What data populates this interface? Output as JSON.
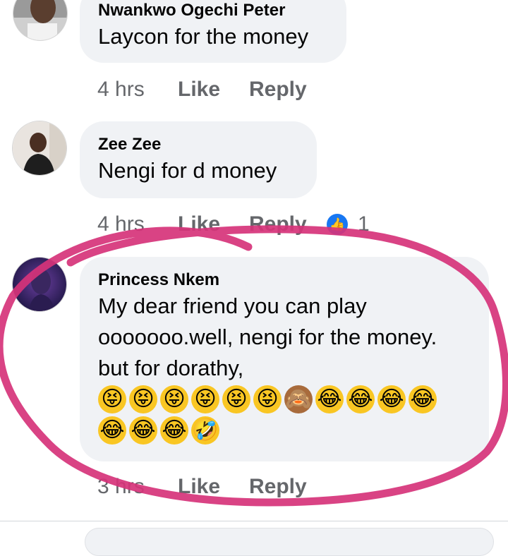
{
  "comments": [
    {
      "author": "Nwankwo Ogechi Peter",
      "text": "Laycon for the money",
      "time": "4 hrs",
      "like_label": "Like",
      "reply_label": "Reply"
    },
    {
      "author": "Zee Zee",
      "text": "Nengi for d money",
      "time": "4 hrs",
      "like_label": "Like",
      "reply_label": "Reply",
      "reaction_count": "1"
    },
    {
      "author": "Princess Nkem",
      "text_lines": [
        "My dear friend you can play",
        "ooooooo.well, nengi for the money.",
        "but for dorathy,"
      ],
      "emoji_row_1": [
        "😝",
        "😝",
        "😝",
        "😝",
        "😝",
        "😝",
        "🙈",
        "😂",
        "😂",
        "😂",
        "😂"
      ],
      "emoji_row_2": [
        "😂",
        "😂",
        "😂",
        "🤣"
      ],
      "time": "3 hrs",
      "like_label": "Like",
      "reply_label": "Reply"
    }
  ],
  "colors": {
    "bubble": "#f0f2f5",
    "meta_text": "#65676b",
    "like_blue": "#1877f2",
    "annotation_pink": "#d6337a"
  }
}
